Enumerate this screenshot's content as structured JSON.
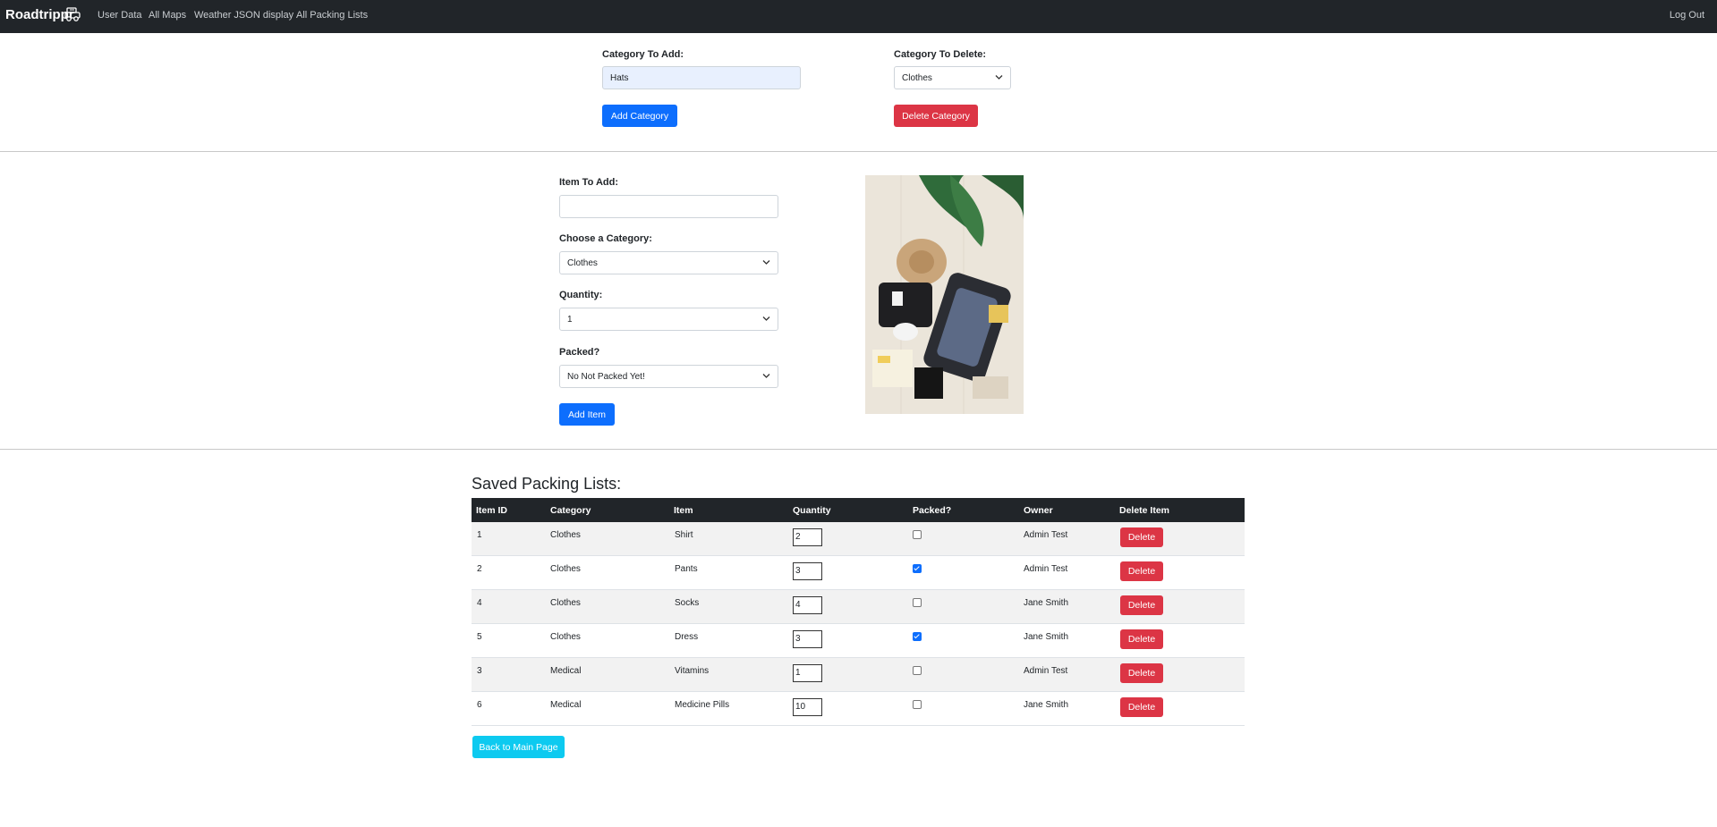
{
  "nav": {
    "brand": "Roadtrippr",
    "brand_icon": "car-icon",
    "links": [
      "User Data",
      "All Maps",
      "Weather JSON display",
      "All Packing Lists"
    ],
    "logout": "Log Out"
  },
  "category_add": {
    "label": "Category To Add:",
    "value": "Hats",
    "button": "Add Category"
  },
  "category_delete": {
    "label": "Category To Delete:",
    "selected": "Clothes",
    "button": "Delete Category"
  },
  "item_form": {
    "item_label": "Item To Add:",
    "item_value": "",
    "category_label": "Choose a Category:",
    "category_selected": "Clothes",
    "quantity_label": "Quantity:",
    "quantity_selected": "1",
    "packed_label": "Packed?",
    "packed_selected": "No Not Packed Yet!",
    "button": "Add Item"
  },
  "table": {
    "title": "Saved Packing Lists:",
    "headers": [
      "Item ID",
      "Category",
      "Item",
      "Quantity",
      "Packed?",
      "Owner",
      "Delete Item"
    ],
    "delete_label": "Delete",
    "rows": [
      {
        "id": "1",
        "category": "Clothes",
        "item": "Shirt",
        "quantity": "2",
        "packed": false,
        "owner": "Admin Test"
      },
      {
        "id": "2",
        "category": "Clothes",
        "item": "Pants",
        "quantity": "3",
        "packed": true,
        "owner": "Admin Test"
      },
      {
        "id": "4",
        "category": "Clothes",
        "item": "Socks",
        "quantity": "4",
        "packed": false,
        "owner": "Jane Smith"
      },
      {
        "id": "5",
        "category": "Clothes",
        "item": "Dress",
        "quantity": "3",
        "packed": true,
        "owner": "Jane Smith"
      },
      {
        "id": "3",
        "category": "Medical",
        "item": "Vitamins",
        "quantity": "1",
        "packed": false,
        "owner": "Admin Test"
      },
      {
        "id": "6",
        "category": "Medical",
        "item": "Medicine Pills",
        "quantity": "10",
        "packed": false,
        "owner": "Jane Smith"
      }
    ]
  },
  "back_button": "Back to Main Page",
  "colors": {
    "navbar": "#212529",
    "primary": "#0d6efd",
    "danger": "#dc3545",
    "info": "#0dcaf0"
  }
}
